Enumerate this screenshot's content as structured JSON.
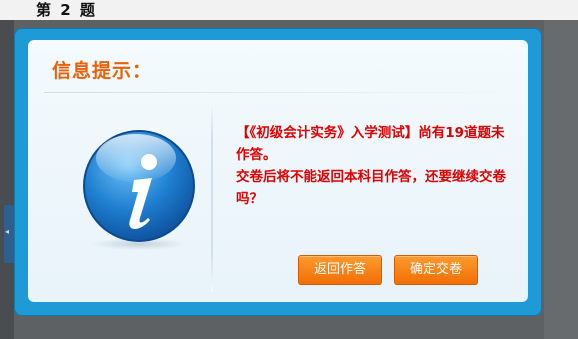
{
  "background": {
    "question_label": "第 2 题"
  },
  "dialog": {
    "title": "信息提示：",
    "message_line1": "【《初级会计实务》入学测试】尚有19道题未作答。",
    "message_line2": "交卷后将不能返回本科目作答，还要继续交卷吗？",
    "icon": "info-icon",
    "buttons": {
      "return_label": "返回作答",
      "confirm_label": "确定交卷"
    }
  },
  "colors": {
    "frame": "#1e9ad6",
    "title": "#e8620a",
    "message": "#e00000",
    "button": "#f58515"
  }
}
